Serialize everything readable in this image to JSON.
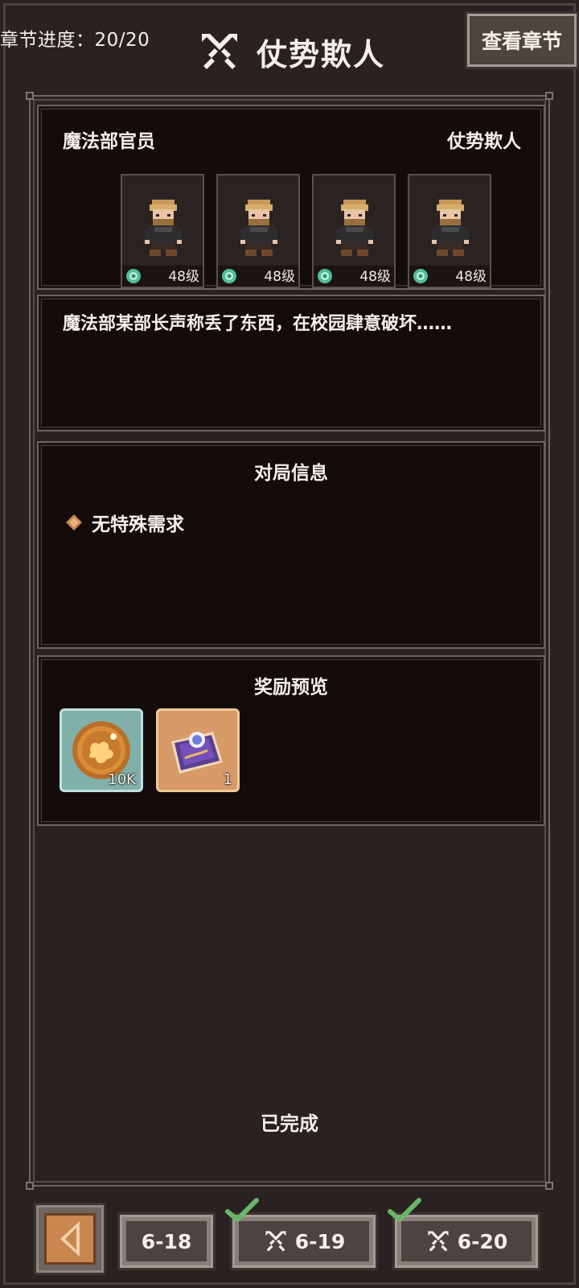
{
  "header": {
    "progress_text": "章节进度：20/20",
    "title": "仗势欺人",
    "view_chapter_label": "查看章节"
  },
  "encounter": {
    "enemy_name": "魔法部官员",
    "stage_name": "仗势欺人",
    "enemies": [
      {
        "level": "48级"
      },
      {
        "level": "48级"
      },
      {
        "level": "48级"
      },
      {
        "level": "48级"
      }
    ]
  },
  "description": "魔法部某部长声称丢了东西，在校园肆意破坏……",
  "battle_info": {
    "title": "对局信息",
    "requirement": "无特殊需求"
  },
  "rewards": {
    "title": "奖励预览",
    "items": [
      {
        "icon": "gold-coin-icon",
        "count": "10K"
      },
      {
        "icon": "ticket-icon",
        "count": "1"
      }
    ]
  },
  "status": "已完成",
  "stage_nav": {
    "tabs": [
      {
        "label": "6-18",
        "completed": false
      },
      {
        "label": "6-19",
        "completed": true
      },
      {
        "label": "6-20",
        "completed": true
      }
    ]
  },
  "colors": {
    "panel_bg": "#130c0b",
    "frame": "#6c6561",
    "check_green": "#69b66a"
  }
}
